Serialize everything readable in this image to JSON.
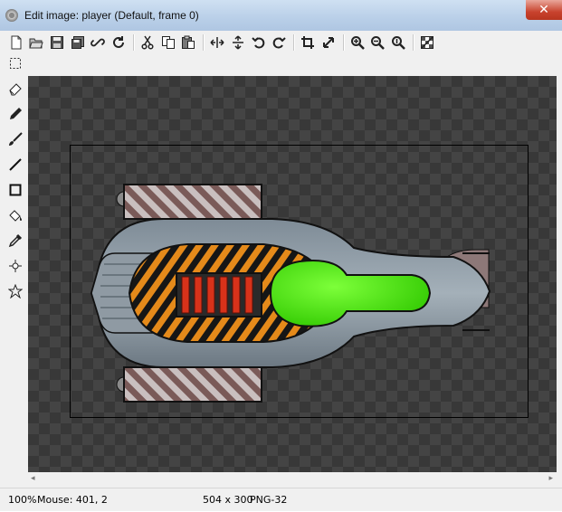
{
  "window": {
    "title": "Edit image: player (Default, frame 0)",
    "close_label": "✕"
  },
  "toolbar": {
    "buttons": [
      {
        "name": "new-icon"
      },
      {
        "name": "open-icon"
      },
      {
        "name": "save-icon"
      },
      {
        "name": "save-as-icon"
      },
      {
        "name": "link-icon"
      },
      {
        "name": "reload-icon"
      },
      {
        "name": "cut-icon"
      },
      {
        "name": "copy-icon"
      },
      {
        "name": "paste-icon"
      },
      {
        "name": "flip-horizontal-icon"
      },
      {
        "name": "flip-vertical-icon"
      },
      {
        "name": "rotate-left-icon"
      },
      {
        "name": "rotate-right-icon"
      },
      {
        "name": "crop-icon"
      },
      {
        "name": "resize-icon"
      },
      {
        "name": "zoom-in-icon"
      },
      {
        "name": "zoom-out-icon"
      },
      {
        "name": "zoom-reset-icon"
      },
      {
        "name": "transparency-icon"
      }
    ]
  },
  "tools": [
    "select-rectangle-icon",
    "eraser-icon",
    "pencil-icon",
    "brush-icon",
    "line-icon",
    "rectangle-icon",
    "fill-bucket-icon",
    "eyedropper-icon",
    "origin-icon",
    "polygon-icon"
  ],
  "colors": {
    "accent_green": "#3bd900",
    "hazard_orange": "#e58a1a",
    "engine_red": "#d8321a",
    "hull_gray": "#76848f"
  },
  "status": {
    "zoom": "100%",
    "mouse": "Mouse: 401, 2",
    "size": "504 x 300",
    "format": "PNG-32"
  },
  "scrollbar": {
    "left_arrow": "◂",
    "right_arrow": "▸"
  }
}
